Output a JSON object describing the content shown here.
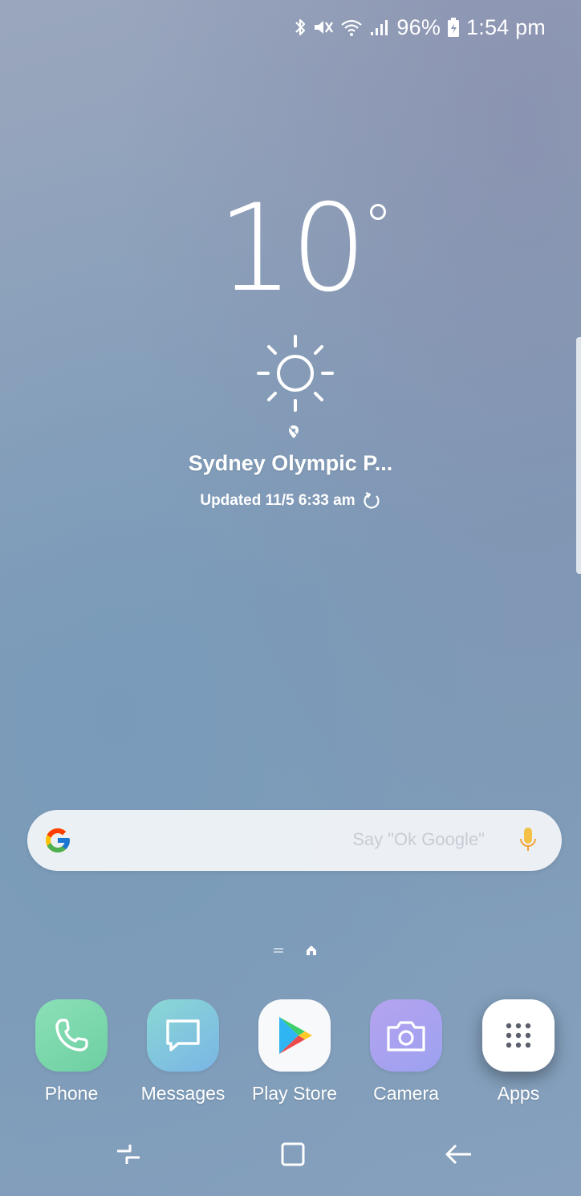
{
  "status_bar": {
    "battery_percent": "96%",
    "time": "1:54 pm",
    "icons": [
      "bluetooth-icon",
      "mute-icon",
      "wifi-icon",
      "signal-icon",
      "battery-icon"
    ]
  },
  "weather": {
    "temperature": "10",
    "condition_icon": "sun-icon",
    "location": "Sydney Olympic P...",
    "updated": "Updated 11/5 6:33 am"
  },
  "search": {
    "placeholder": "Say \"Ok Google\"",
    "icons": [
      "google-g-icon",
      "mic-icon"
    ]
  },
  "dock": {
    "apps": [
      {
        "label": "Phone"
      },
      {
        "label": "Messages"
      },
      {
        "label": "Play Store"
      },
      {
        "label": "Camera"
      },
      {
        "label": "Apps"
      }
    ]
  },
  "nav": {
    "buttons": [
      "recents-button",
      "home-button",
      "back-button"
    ]
  },
  "colors": {
    "phone": "#7dd8ad",
    "messages": "#82c7dd",
    "camera": "#a9a2ef",
    "mic": "#f4c046"
  }
}
